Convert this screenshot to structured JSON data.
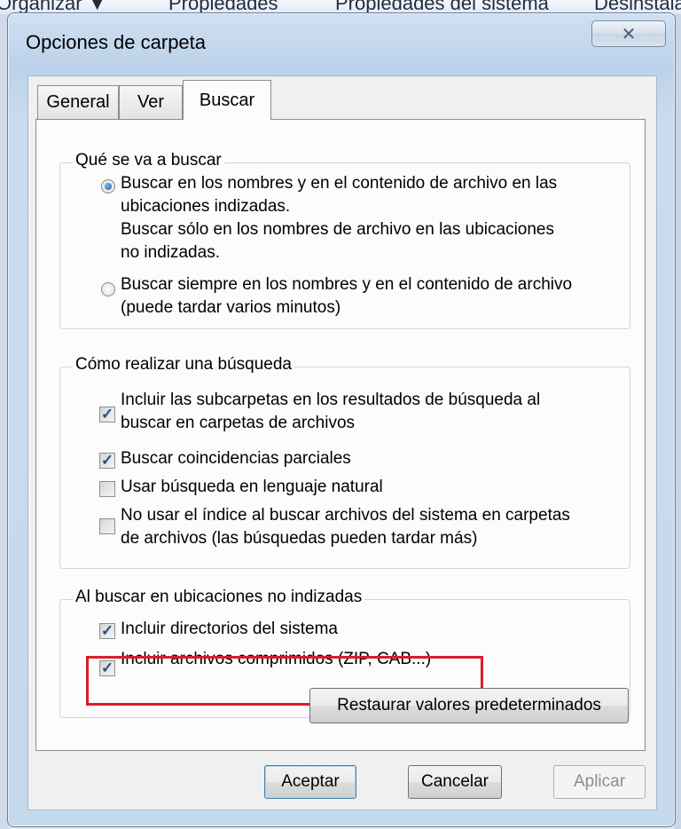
{
  "background": {
    "toolbar_items": [
      "Organizar ▼",
      "Propiedades",
      "Propiedades del sistema",
      "Desinstalar"
    ]
  },
  "dialog": {
    "title": "Opciones de carpeta",
    "close_glyph": "✕",
    "tabs": [
      {
        "label": "General",
        "active": false
      },
      {
        "label": "Ver",
        "active": false
      },
      {
        "label": "Buscar",
        "active": true
      }
    ],
    "group_what": {
      "legend": "Qué se va a buscar",
      "option1_lines": [
        "Buscar en los nombres y en el contenido de archivo en las",
        "ubicaciones indizadas.",
        "Buscar sólo en los nombres de archivo en las ubicaciones",
        "no indizadas."
      ],
      "option1_checked": true,
      "option2_lines": [
        "Buscar siempre en los nombres y en el contenido de archivo",
        "(puede tardar varios minutos)"
      ],
      "option2_checked": false
    },
    "group_how": {
      "legend": "Cómo realizar una búsqueda",
      "items": [
        {
          "lines": [
            "Incluir las subcarpetas en los resultados de búsqueda al",
            "buscar en carpetas de archivos"
          ],
          "checked": true
        },
        {
          "lines": [
            "Buscar coincidencias parciales"
          ],
          "checked": true
        },
        {
          "lines": [
            "Usar búsqueda en lenguaje natural"
          ],
          "checked": false
        },
        {
          "lines": [
            "No usar el índice al buscar archivos del sistema en carpetas",
            "de archivos (las búsquedas pueden tardar más)"
          ],
          "checked": false
        }
      ]
    },
    "group_nonindexed": {
      "legend": "Al buscar en ubicaciones no indizadas",
      "items": [
        {
          "label": "Incluir directorios del sistema",
          "checked": true
        },
        {
          "label": "Incluir archivos comprimidos (ZIP, CAB...)",
          "checked": true
        }
      ]
    },
    "restore_label": "Restaurar valores predeterminados",
    "ok_label": "Aceptar",
    "cancel_label": "Cancelar",
    "apply_label": "Aplicar",
    "check_glyph": "✓",
    "highlight_color": "#d81e2a"
  }
}
